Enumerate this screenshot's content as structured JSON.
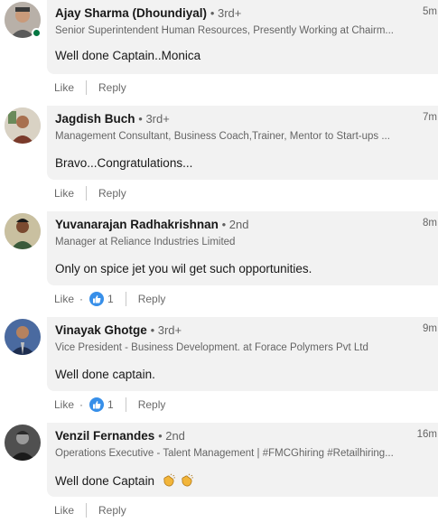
{
  "comments": [
    {
      "name": "Ajay Sharma (Dhoundiyal)",
      "degree": "• 3rd+",
      "headline": "Senior Superintendent Human Resources, Presently Working at Chairm...",
      "time": "5m",
      "text": "Well done Captain..Monica",
      "like_label": "Like",
      "reply_label": "Reply",
      "online": true
    },
    {
      "name": "Jagdish Buch",
      "degree": "• 3rd+",
      "headline": "Management Consultant, Business Coach,Trainer, Mentor to Start-ups ...",
      "time": "7m",
      "text": "Bravo...Congratulations...",
      "like_label": "Like",
      "reply_label": "Reply"
    },
    {
      "name": "Yuvanarajan Radhakrishnan",
      "degree": "• 2nd",
      "headline": "Manager at Reliance Industries Limited",
      "time": "8m",
      "text": "Only on spice jet you wil get such opportunities.",
      "like_label": "Like",
      "reply_label": "Reply",
      "reaction_count": "1",
      "reaction_dot": "·"
    },
    {
      "name": "Vinayak Ghotge",
      "degree": "• 3rd+",
      "headline": "Vice President - Business Development. at Forace Polymers Pvt Ltd",
      "time": "9m",
      "text": "Well done captain.",
      "like_label": "Like",
      "reply_label": "Reply",
      "reaction_count": "1",
      "reaction_dot": "·"
    },
    {
      "name": "Venzil Fernandes",
      "degree": "• 2nd",
      "headline": "Operations Executive - Talent Management | #FMCGhiring #Retailhiring...",
      "time": "16m",
      "text": "Well done Captain",
      "like_label": "Like",
      "reply_label": "Reply"
    }
  ],
  "colors": {
    "bubble": "#f2f2f2",
    "like_blue": "#378fe9",
    "online_green": "#057642"
  }
}
